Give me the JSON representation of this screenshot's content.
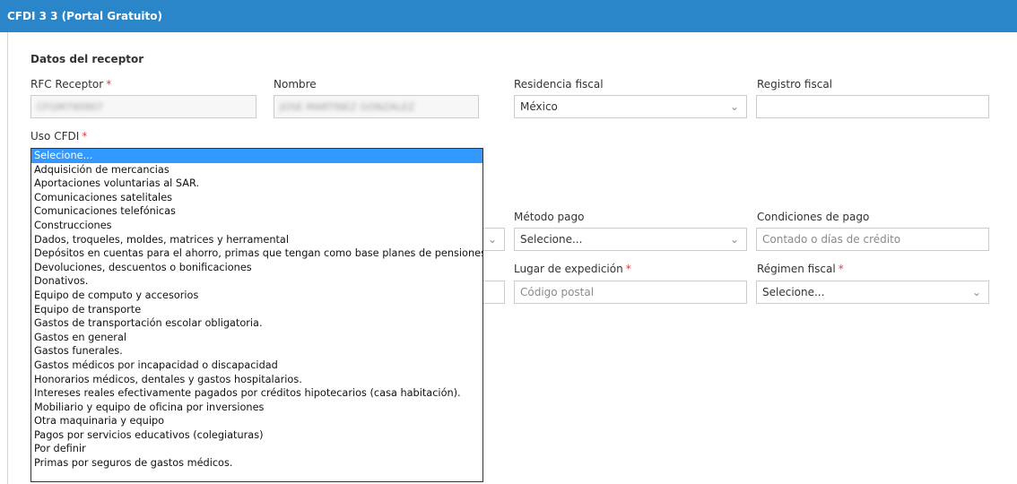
{
  "header": {
    "title": "CFDI 3 3 (Portal Gratuito)"
  },
  "receptor": {
    "section_title": "Datos del receptor",
    "rfc_label": "RFC Receptor",
    "rfc_value": "CFGM790907",
    "nombre_label": "Nombre",
    "nombre_value": "JOSE MARTINEZ GONZALEZ",
    "residencia_label": "Residencia fiscal",
    "residencia_value": "México",
    "registro_label": "Registro fiscal",
    "registro_value": "",
    "required_mark": "*"
  },
  "uso_cfdi": {
    "label": "Uso CFDI",
    "options": [
      "Selecione...",
      "Adquisición de mercancias",
      "Aportaciones voluntarias al SAR.",
      "Comunicaciones satelitales",
      "Comunicaciones telefónicas",
      "Construcciones",
      "Dados, troqueles, moldes, matrices y herramental",
      "Depósitos en cuentas para el ahorro, primas que tengan como base planes de pensiones.",
      "Devoluciones, descuentos o bonificaciones",
      "Donativos.",
      "Equipo de computo y accesorios",
      "Equipo de transporte",
      "Gastos de transportación escolar obligatoria.",
      "Gastos en general",
      "Gastos funerales.",
      "Gastos médicos por incapacidad o discapacidad",
      "Honorarios médicos, dentales y gastos hospitalarios.",
      "Intereses reales efectivamente pagados por créditos hipotecarios (casa habitación).",
      "Mobiliario y equipo de oficina por inversiones",
      "Otra maquinaria y equipo",
      "Pagos por servicios educativos (colegiaturas)",
      "Por definir",
      "Primas por seguros de gastos médicos."
    ],
    "selected_index": 0
  },
  "pago": {
    "metodo_label": "Método pago",
    "metodo_value": "Selecione...",
    "condiciones_label": "Condiciones de pago",
    "condiciones_placeholder": "Contado o días de crédito"
  },
  "expedicion": {
    "lugar_label": "Lugar de expedición",
    "lugar_placeholder": "Código postal",
    "regimen_label": "Régimen fiscal",
    "regimen_value": "Selecione..."
  },
  "colors": {
    "header": "#2a86c9",
    "required": "#e03a3a",
    "selected": "#3399ff"
  },
  "icons": {
    "dropdown": "chevron-down-icon"
  }
}
